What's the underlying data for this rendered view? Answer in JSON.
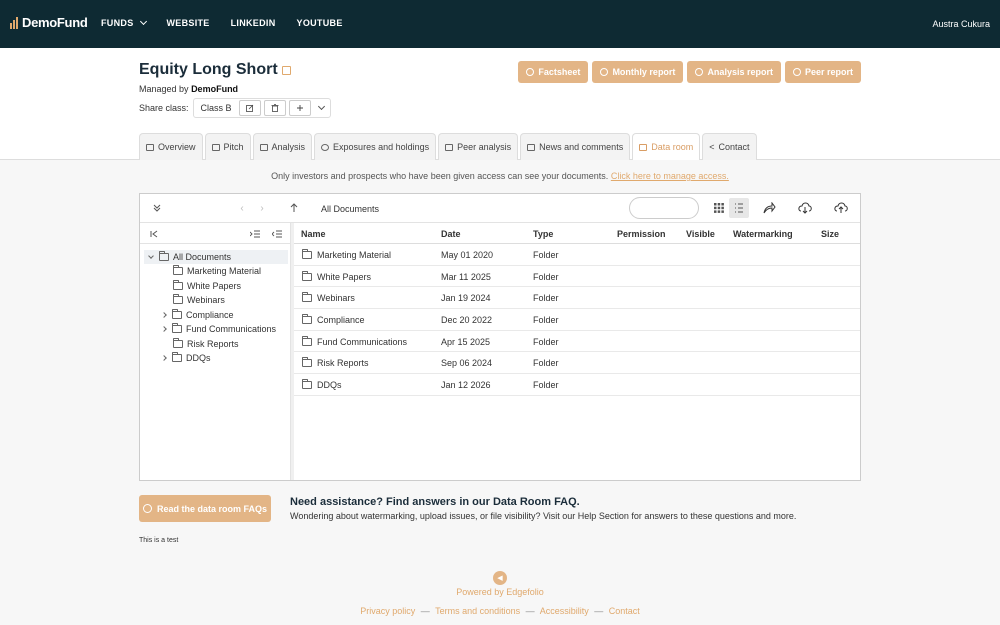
{
  "brand": {
    "name": "DemoFund",
    "accent": "#e3b586",
    "nav_bg": "#0e2a33"
  },
  "nav": {
    "items": [
      {
        "label": "FUNDS",
        "icon": "chevron-down-icon"
      },
      {
        "label": "WEBSITE"
      },
      {
        "label": "LINKEDIN"
      },
      {
        "label": "YOUTUBE"
      }
    ],
    "user": "Austra Cukura"
  },
  "fund": {
    "title": "Equity Long Short",
    "managed_prefix": "Managed by",
    "manager": "DemoFund",
    "share_class_label": "Share class:",
    "share_class_value": "Class B"
  },
  "reports": [
    {
      "label": "Factsheet",
      "icon": "print-icon"
    },
    {
      "label": "Monthly report",
      "icon": "print-icon"
    },
    {
      "label": "Analysis report",
      "icon": "print-icon"
    },
    {
      "label": "Peer report",
      "icon": "print-icon"
    }
  ],
  "tabs": [
    {
      "label": "Overview",
      "icon": "overview-icon"
    },
    {
      "label": "Pitch",
      "icon": "pitch-icon"
    },
    {
      "label": "Analysis",
      "icon": "analysis-icon"
    },
    {
      "label": "Exposures and holdings",
      "icon": "pie-icon"
    },
    {
      "label": "Peer analysis",
      "icon": "bar-chart-icon"
    },
    {
      "label": "News and comments",
      "icon": "comment-icon"
    },
    {
      "label": "Data room",
      "icon": "folder-icon",
      "active": true
    },
    {
      "label": "Contact",
      "icon": "share-icon"
    }
  ],
  "notice": {
    "text": "Only investors and prospects who have been given access can see your documents.",
    "link": "Click here to manage access."
  },
  "browser": {
    "path": "All Documents",
    "tree": [
      {
        "label": "All Documents",
        "level": 0,
        "expanded": true,
        "selected": true
      },
      {
        "label": "Marketing Material",
        "level": 1
      },
      {
        "label": "White Papers",
        "level": 1
      },
      {
        "label": "Webinars",
        "level": 1
      },
      {
        "label": "Compliance",
        "level": 1,
        "expandable": true
      },
      {
        "label": "Fund Communications",
        "level": 1,
        "expandable": true
      },
      {
        "label": "Risk Reports",
        "level": 1
      },
      {
        "label": "DDQs",
        "level": 1,
        "expandable": true
      }
    ],
    "columns": [
      "Name",
      "Date",
      "Type",
      "Permission",
      "Visible",
      "Watermarking",
      "Size"
    ],
    "rows": [
      {
        "name": "Marketing Material",
        "date": "May 01 2020",
        "type": "Folder"
      },
      {
        "name": "White Papers",
        "date": "Mar 11 2025",
        "type": "Folder"
      },
      {
        "name": "Webinars",
        "date": "Jan 19 2024",
        "type": "Folder"
      },
      {
        "name": "Compliance",
        "date": "Dec 20 2022",
        "type": "Folder"
      },
      {
        "name": "Fund Communications",
        "date": "Apr 15 2025",
        "type": "Folder"
      },
      {
        "name": "Risk Reports",
        "date": "Sep 06 2024",
        "type": "Folder"
      },
      {
        "name": "DDQs",
        "date": "Jan 12 2026",
        "type": "Folder"
      }
    ]
  },
  "help": {
    "button": "Read the data room FAQs",
    "title": "Need assistance? Find answers in our Data Room FAQ.",
    "body": "Wondering about watermarking, upload issues, or file visibility? Visit our Help Section for answers to these questions and more."
  },
  "test_text": "This is a test",
  "footer": {
    "powered": "Powered by Edgefolio",
    "links": [
      "Privacy policy",
      "Terms and conditions",
      "Accessibility",
      "Contact"
    ],
    "separator": "—"
  }
}
